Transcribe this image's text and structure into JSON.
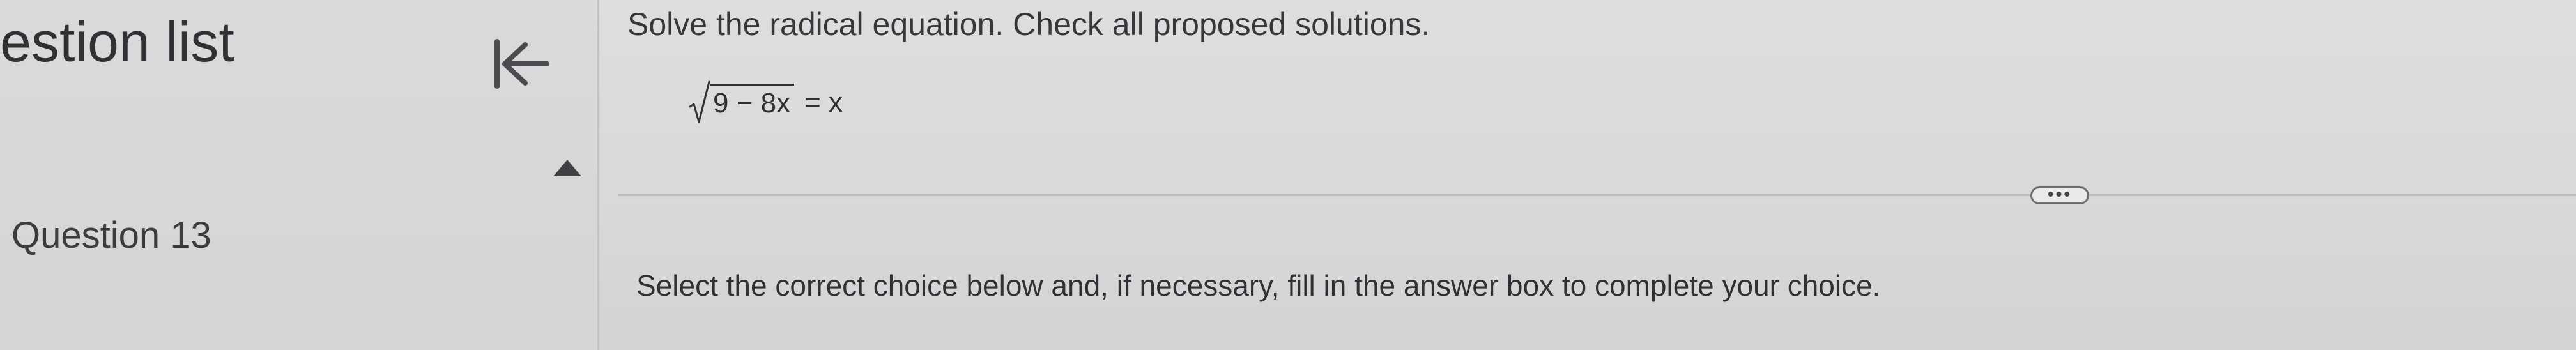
{
  "sidebar": {
    "title": "estion list",
    "collapse_icon": "collapse-left-icon",
    "scroll_icon": "triangle-up-icon",
    "question_label": "Question 13"
  },
  "problem": {
    "instruction": "Solve the radical equation. Check all proposed solutions.",
    "equation": {
      "radicand": "9 − 8x",
      "rhs": "= x"
    },
    "more_button_label": "•••",
    "select_instruction": "Select the correct choice below and, if necessary, fill in the answer box to complete your choice."
  },
  "colors": {
    "background": "#d9dadb",
    "text": "#2f3134",
    "divider": "#b9babc"
  }
}
